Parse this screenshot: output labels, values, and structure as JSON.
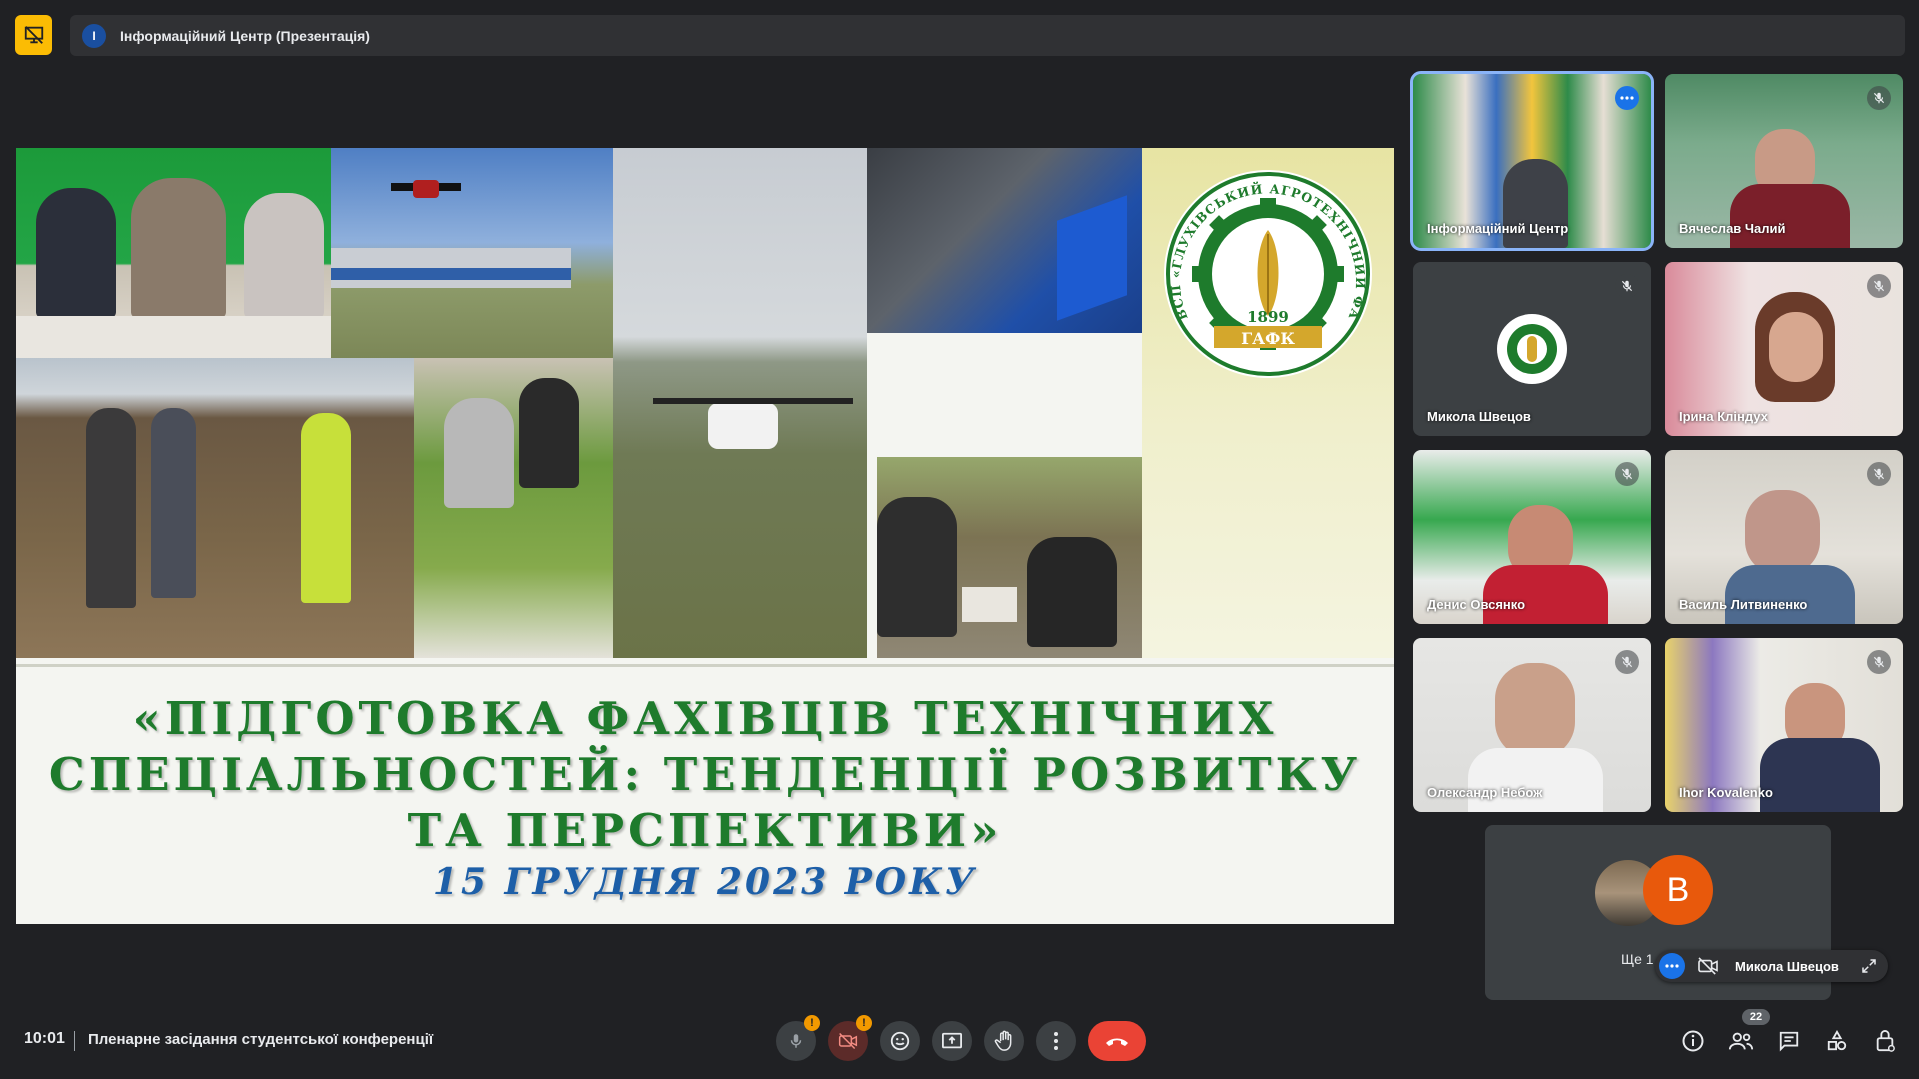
{
  "top_bar": {
    "avatar_letter": "I",
    "title": "Інформаційний Центр (Презентація)"
  },
  "slide": {
    "logo_text": "ВСП «ГЛУХІВСЬКИЙ АГРОТЕХНІЧНИЙ ФАХОВИЙ КОЛЕДЖ СНАУ»",
    "logo_year": "1899",
    "logo_abbr": "ГАФК",
    "title_lines": [
      "«ПІДГОТОВКА ФАХІВЦІВ ТЕХНІЧНИХ",
      "СПЕЦІАЛЬНОСТЕЙ: ТЕНДЕНЦІЇ РОЗВИТКУ",
      "ТА ПЕРСПЕКТИВИ»"
    ],
    "date": "15 ГРУДНЯ 2023 РОКУ",
    "brand_green": "#1e7b2c",
    "brand_blue": "#1d5fa8"
  },
  "participants": [
    {
      "name": "Інформаційний Центр",
      "active": true,
      "muted": false
    },
    {
      "name": "Вячеслав Чалий",
      "muted": true
    },
    {
      "name": "Микола Швецов",
      "muted": true
    },
    {
      "name": "Ірина Кліндух",
      "muted": true
    },
    {
      "name": "Денис Овсянко",
      "muted": true
    },
    {
      "name": "Василь Литвиненко",
      "muted": true
    },
    {
      "name": "Олександр Небож",
      "muted": true
    },
    {
      "name": "Ihor Kovalenko",
      "muted": true
    }
  ],
  "others": {
    "letter": "B",
    "label": "Ще 1",
    "pinned_name": "Микола Швецов"
  },
  "bottom_bar": {
    "time": "10:01",
    "meeting_title": "Пленарне засідання студентської конференції",
    "people_count": "22",
    "warning_mark": "!"
  },
  "icons": {
    "top_left": "presentation-off-icon",
    "mic": "mic-off-icon",
    "camera": "camera-off-icon",
    "emoji": "emoji-icon",
    "present": "present-screen-icon",
    "hand": "raise-hand-icon",
    "more": "more-vert-icon",
    "end": "end-call-icon",
    "info": "info-icon",
    "people": "people-icon",
    "chat": "chat-icon",
    "activities": "activities-icon",
    "host": "host-controls-icon"
  }
}
